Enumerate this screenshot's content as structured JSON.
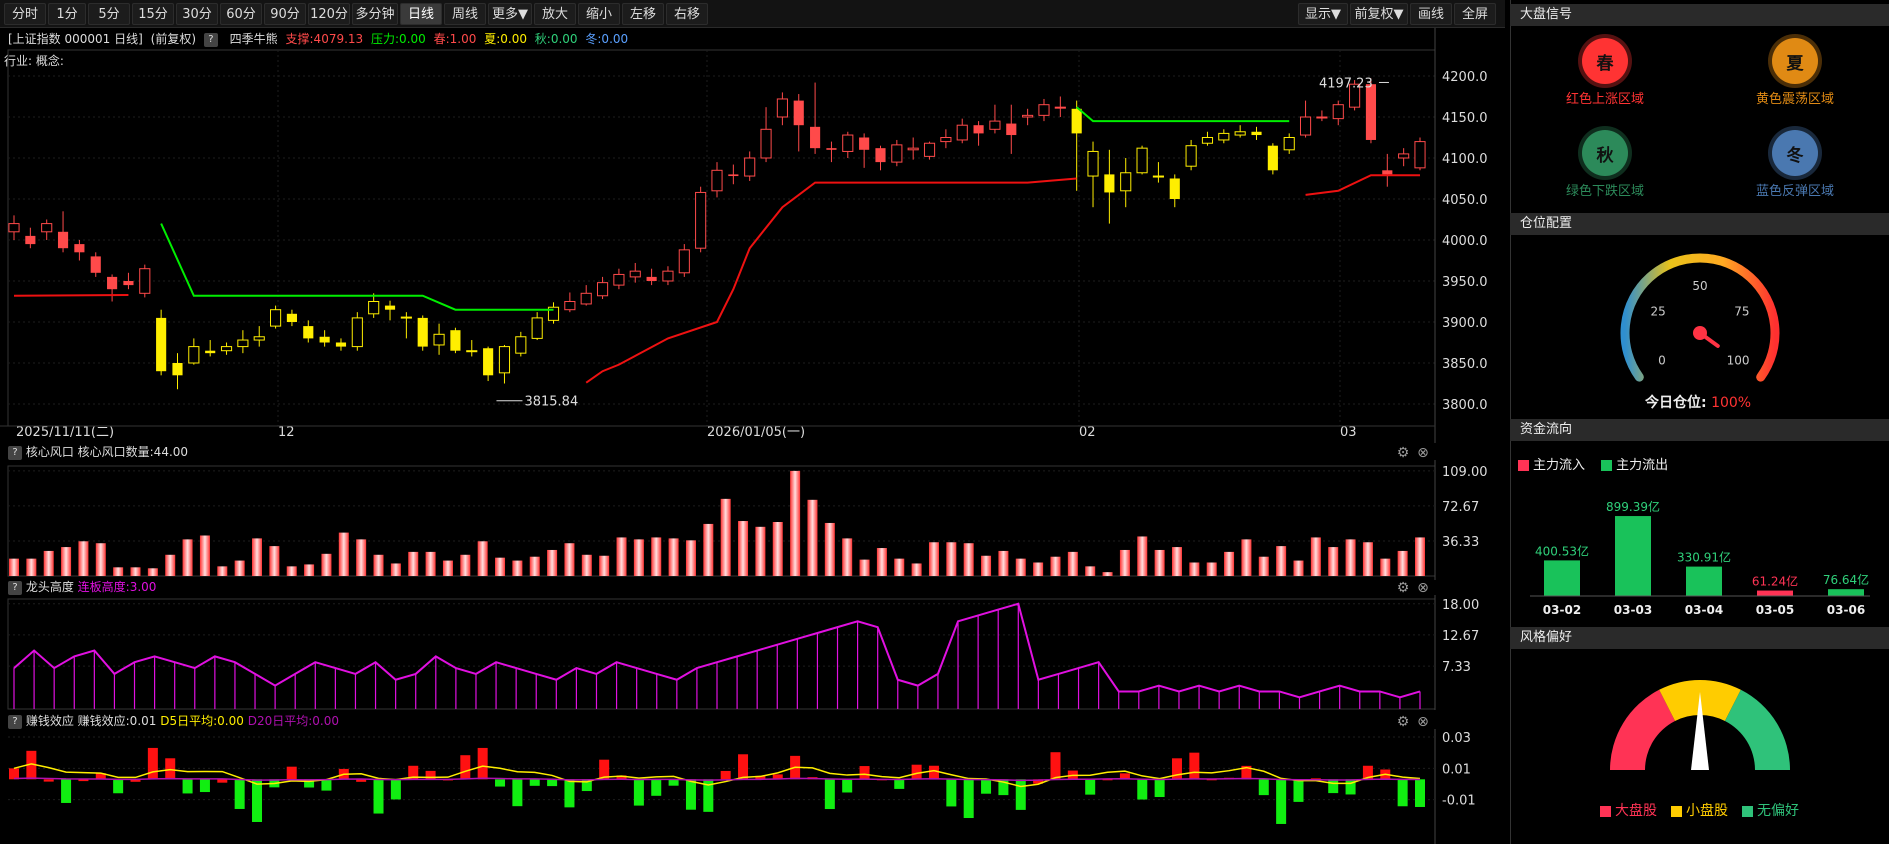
{
  "toolbar": {
    "periods": [
      "分时",
      "1分",
      "5分",
      "15分",
      "30分",
      "60分",
      "90分",
      "120分",
      "多分钟",
      "日线",
      "周线",
      "更多▼",
      "放大",
      "缩小",
      "左移",
      "右移"
    ],
    "active": "日线",
    "right_buttons": [
      "显示▼",
      "前复权▼",
      "画线",
      "全屏"
    ]
  },
  "info": {
    "title": "[上证指数 000001 日线]",
    "adjust": "(前复权)",
    "q": "?",
    "indicator": "四季牛熊",
    "support": "支撑:4079.13",
    "pressure": "压力:0.00",
    "spring": "春:1.00",
    "summer": "夏:0.00",
    "autumn": "秋:0.00",
    "winter": "冬:0.00",
    "industry": "行业: 概念:"
  },
  "colors": {
    "up": "#ff4a4a",
    "down_green": "#2fd07a",
    "yellow": "#ffee00",
    "line_green": "#00ee00",
    "line_red": "#ee1111",
    "magenta": "#e010e0"
  },
  "main_chart": {
    "y_ticks": [
      "4200.0",
      "4150.0",
      "4100.0",
      "4050.0",
      "4000.0",
      "3950.0",
      "3900.0",
      "3850.0",
      "3800.0"
    ],
    "x_labels": [
      "2025/11/11(二)",
      "12",
      "2026/01/05(一)",
      "02",
      "03"
    ],
    "high_label": "4197.23",
    "low_label": "3815.84"
  },
  "panel1": {
    "label": "核心风口 核心风口数量:44.00",
    "y_ticks": [
      "109.00",
      "72.67",
      "36.33"
    ]
  },
  "panel2": {
    "label_a": "龙头高度",
    "label_b": "连板高度:3.00",
    "y_ticks": [
      "18.00",
      "12.67",
      "7.33"
    ]
  },
  "panel3": {
    "label_a": "赚钱效应 赚钱效应:0.01",
    "label_b": "D5日平均:0.00",
    "label_c": "D20日平均:0.00",
    "y_ticks": [
      "0.03",
      "0.01",
      "-0.01"
    ]
  },
  "market_signal": {
    "title": "大盘信号",
    "items": [
      {
        "glyph": "春",
        "label": "红色上涨区域",
        "color": "#ff3333"
      },
      {
        "glyph": "夏",
        "label": "黄色震荡区域",
        "color": "#e08a14"
      },
      {
        "glyph": "秋",
        "label": "绿色下跌区域",
        "color": "#2c8a5a"
      },
      {
        "glyph": "冬",
        "label": "蓝色反弹区域",
        "color": "#4a78b0"
      }
    ]
  },
  "position": {
    "title": "仓位配置",
    "ticks": [
      "0",
      "25",
      "50",
      "75",
      "100"
    ],
    "label": "今日仓位:",
    "value": "100%",
    "level": 100
  },
  "flow": {
    "title": "资金流向",
    "legend_in": "主力流入",
    "legend_out": "主力流出",
    "bars": [
      {
        "date": "03-02",
        "value": 400.53,
        "label": "400.53亿",
        "type": "out"
      },
      {
        "date": "03-03",
        "value": 899.39,
        "label": "899.39亿",
        "type": "out"
      },
      {
        "date": "03-04",
        "value": 330.91,
        "label": "330.91亿",
        "type": "out"
      },
      {
        "date": "03-05",
        "value": 61.24,
        "label": "61.24亿",
        "type": "in"
      },
      {
        "date": "03-06",
        "value": 76.64,
        "label": "76.64亿",
        "type": "out"
      }
    ]
  },
  "style": {
    "title": "风格偏好",
    "legend": [
      {
        "label": "大盘股",
        "color": "#ff3355"
      },
      {
        "label": "小盘股",
        "color": "#ffcc00"
      },
      {
        "label": "无偏好",
        "color": "#2fc27a"
      }
    ]
  },
  "chart_data": {
    "type": "candlestick",
    "candles": [
      [
        4010,
        4020,
        4030,
        4000
      ],
      [
        4005,
        3995,
        4015,
        3990
      ],
      [
        4010,
        4020,
        4025,
        4000
      ],
      [
        4010,
        3990,
        4035,
        3985
      ],
      [
        3995,
        3985,
        4000,
        3975
      ],
      [
        3980,
        3960,
        3985,
        3955
      ],
      [
        3955,
        3940,
        3958,
        3925
      ],
      [
        3950,
        3945,
        3960,
        3940
      ],
      [
        3935,
        3965,
        3970,
        3930
      ],
      [
        3905,
        3840,
        3915,
        3835
      ],
      [
        3850,
        3835,
        3862,
        3818
      ],
      [
        3850,
        3870,
        3880,
        3848
      ],
      [
        3865,
        3862,
        3878,
        3858
      ],
      [
        3865,
        3870,
        3875,
        3860
      ],
      [
        3870,
        3878,
        3890,
        3862
      ],
      [
        3878,
        3882,
        3895,
        3870
      ],
      [
        3895,
        3915,
        3920,
        3892
      ],
      [
        3910,
        3900,
        3915,
        3895
      ],
      [
        3895,
        3880,
        3902,
        3875
      ],
      [
        3882,
        3875,
        3890,
        3870
      ],
      [
        3875,
        3870,
        3880,
        3865
      ],
      [
        3870,
        3905,
        3912,
        3865
      ],
      [
        3910,
        3925,
        3935,
        3905
      ],
      [
        3920,
        3915,
        3926,
        3902
      ],
      [
        3905,
        3906,
        3912,
        3880
      ],
      [
        3905,
        3870,
        3908,
        3865
      ],
      [
        3872,
        3885,
        3898,
        3860
      ],
      [
        3890,
        3865,
        3893,
        3862
      ],
      [
        3865,
        3865,
        3878,
        3858
      ],
      [
        3868,
        3835,
        3870,
        3828
      ],
      [
        3838,
        3870,
        3872,
        3825
      ],
      [
        3862,
        3882,
        3888,
        3858
      ],
      [
        3880,
        3905,
        3912,
        3878
      ],
      [
        3902,
        3918,
        3924,
        3898
      ],
      [
        3915,
        3925,
        3936,
        3912
      ],
      [
        3922,
        3935,
        3945,
        3920
      ],
      [
        3932,
        3948,
        3955,
        3928
      ],
      [
        3945,
        3958,
        3965,
        3940
      ],
      [
        3955,
        3962,
        3972,
        3948
      ],
      [
        3955,
        3950,
        3965,
        3945
      ],
      [
        3950,
        3962,
        3968,
        3945
      ],
      [
        3960,
        3988,
        3995,
        3955
      ],
      [
        3990,
        4058,
        4065,
        3985
      ],
      [
        4060,
        4085,
        4095,
        4052
      ],
      [
        4080,
        4078,
        4092,
        4068
      ],
      [
        4078,
        4100,
        4108,
        4072
      ],
      [
        4100,
        4135,
        4162,
        4095
      ],
      [
        4150,
        4172,
        4180,
        4140
      ],
      [
        4170,
        4140,
        4178,
        4108
      ],
      [
        4138,
        4112,
        4192,
        4105
      ],
      [
        4112,
        4110,
        4120,
        4095
      ],
      [
        4108,
        4128,
        4132,
        4100
      ],
      [
        4125,
        4110,
        4130,
        4088
      ],
      [
        4112,
        4095,
        4115,
        4085
      ],
      [
        4095,
        4116,
        4122,
        4090
      ],
      [
        4110,
        4112,
        4125,
        4098
      ],
      [
        4102,
        4118,
        4120,
        4098
      ],
      [
        4120,
        4125,
        4135,
        4112
      ],
      [
        4122,
        4140,
        4148,
        4118
      ],
      [
        4140,
        4130,
        4145,
        4115
      ],
      [
        4135,
        4145,
        4165,
        4130
      ],
      [
        4142,
        4128,
        4165,
        4105
      ],
      [
        4150,
        4152,
        4160,
        4140
      ],
      [
        4152,
        4165,
        4172,
        4145
      ],
      [
        4162,
        4162,
        4175,
        4150
      ],
      [
        4160,
        4130,
        4170,
        4060
      ],
      [
        4078,
        4108,
        4120,
        4040
      ],
      [
        4080,
        4058,
        4110,
        4020
      ],
      [
        4060,
        4082,
        4100,
        4040
      ],
      [
        4082,
        4112,
        4115,
        4080
      ],
      [
        4078,
        4078,
        4095,
        4070
      ],
      [
        4075,
        4050,
        4080,
        4040
      ],
      [
        4090,
        4115,
        4122,
        4085
      ],
      [
        4118,
        4125,
        4132,
        4115
      ],
      [
        4122,
        4130,
        4135,
        4118
      ],
      [
        4128,
        4132,
        4140,
        4125
      ],
      [
        4132,
        4128,
        4138,
        4122
      ],
      [
        4115,
        4085,
        4118,
        4080
      ],
      [
        4110,
        4125,
        4130,
        4105
      ],
      [
        4128,
        4150,
        4170,
        4125
      ],
      [
        4150,
        4150,
        4158,
        4145
      ],
      [
        4148,
        4165,
        4170,
        4140
      ],
      [
        4162,
        4190,
        4195,
        4158
      ],
      [
        4190,
        4122,
        4197,
        4118
      ],
      [
        4085,
        4080,
        4105,
        4065
      ],
      [
        4100,
        4105,
        4112,
        4090
      ],
      [
        4088,
        4120,
        4125,
        4085
      ]
    ],
    "support_line": {
      "start": 0,
      "values": [
        3933,
        3933,
        3933,
        3933,
        3933,
        3933,
        3933,
        3933,
        3933,
        3933
      ]
    },
    "vol_p1": [
      18,
      18,
      26,
      30,
      36,
      34,
      9,
      9,
      8,
      22,
      38,
      42,
      10,
      16,
      39,
      31,
      10,
      12,
      23,
      45,
      38,
      22,
      13,
      25,
      25,
      16,
      22,
      36,
      19,
      16,
      20,
      27,
      34,
      22,
      21,
      40,
      38,
      40,
      39,
      37,
      54,
      80,
      57,
      51,
      56,
      109,
      79,
      55,
      39,
      17,
      29,
      18,
      13,
      35,
      35,
      34,
      21,
      26,
      18,
      14,
      20,
      25,
      10,
      4,
      27,
      41,
      27,
      30,
      14,
      14,
      25,
      38,
      20,
      31,
      16,
      40,
      30,
      38,
      35,
      18,
      26,
      40
    ],
    "dragon": [
      7,
      10,
      7,
      9,
      10,
      6,
      8,
      9,
      8,
      7,
      9,
      8,
      6,
      4,
      6,
      8,
      7,
      6,
      8,
      5,
      6,
      9,
      7,
      6,
      8,
      7,
      6,
      5,
      7,
      6,
      8,
      7,
      6,
      5,
      7,
      8,
      9,
      10,
      11,
      12,
      13,
      14,
      15,
      14,
      5,
      4,
      6,
      15,
      16,
      17,
      18,
      5,
      6,
      7,
      8,
      3,
      3,
      4,
      3,
      4,
      3,
      4,
      3,
      3,
      2,
      3,
      4,
      3,
      3,
      2,
      3
    ]
  }
}
